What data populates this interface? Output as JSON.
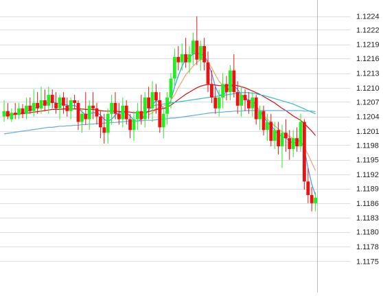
{
  "chart_data": {
    "type": "candlestick",
    "title": "",
    "xlabel": "",
    "ylabel": "",
    "ylim": [
      1.1173,
      1.12265
    ],
    "grid": true,
    "legend": "none",
    "y_ticks": [
      "1.1224",
      "1.1222",
      "1.1219",
      "1.1216",
      "1.1213",
      "1.1210",
      "1.1207",
      "1.1204",
      "1.1201",
      "1.1198",
      "1.1195",
      "1.1192",
      "1.1189",
      "1.1186",
      "1.1183",
      "1.1180",
      "1.1178",
      "1.1175"
    ],
    "y_tick_values": [
      1.1224,
      1.12215,
      1.12188,
      1.12162,
      1.12135,
      1.12108,
      1.12082,
      1.12055,
      1.12028,
      1.12002,
      1.11975,
      1.11948,
      1.11922,
      1.11895,
      1.11868,
      1.11842,
      1.11815,
      1.11788
    ],
    "colors": {
      "up": "#22ee22",
      "down": "#ee1111",
      "ma_short": "#3399ff",
      "ma_mid": "#f0a070",
      "ma_long": "#cc1111",
      "ma_longer": "#33bbcc",
      "ma_longest": "#66aadd",
      "grid": "#dddddd",
      "axis": "#bbbbbb",
      "label": "#222222"
    },
    "candles": [
      [
        1.12055,
        1.12085,
        1.12045,
        1.12065
      ],
      [
        1.12065,
        1.1208,
        1.1205,
        1.12055
      ],
      [
        1.1205,
        1.1207,
        1.12045,
        1.12062
      ],
      [
        1.12062,
        1.1208,
        1.1205,
        1.12058
      ],
      [
        1.12058,
        1.1208,
        1.1205,
        1.1207
      ],
      [
        1.1207,
        1.12078,
        1.12052,
        1.1206
      ],
      [
        1.1206,
        1.1209,
        1.1205,
        1.12075
      ],
      [
        1.12075,
        1.1209,
        1.1206,
        1.12065
      ],
      [
        1.12065,
        1.12105,
        1.12055,
        1.1208
      ],
      [
        1.1208,
        1.121,
        1.1206,
        1.1207
      ],
      [
        1.1207,
        1.1211,
        1.1206,
        1.12085
      ],
      [
        1.12085,
        1.12105,
        1.12065,
        1.12075
      ],
      [
        1.12075,
        1.1211,
        1.1206,
        1.12095
      ],
      [
        1.12095,
        1.12105,
        1.1207,
        1.1208
      ],
      [
        1.1208,
        1.121,
        1.1206,
        1.1207
      ],
      [
        1.1207,
        1.12095,
        1.1205,
        1.1209
      ],
      [
        1.1209,
        1.121,
        1.1206,
        1.12075
      ],
      [
        1.12075,
        1.1209,
        1.12055,
        1.12065
      ],
      [
        1.12065,
        1.1209,
        1.1205,
        1.12085
      ],
      [
        1.12085,
        1.12095,
        1.1207,
        1.1208
      ],
      [
        1.1208,
        1.12085,
        1.1203,
        1.12045
      ],
      [
        1.12045,
        1.1207,
        1.12025,
        1.1206
      ],
      [
        1.1206,
        1.121,
        1.1204,
        1.1205
      ],
      [
        1.1205,
        1.12085,
        1.1203,
        1.12075
      ],
      [
        1.12075,
        1.121,
        1.1205,
        1.1207
      ],
      [
        1.1207,
        1.1208,
        1.1204,
        1.12055
      ],
      [
        1.12055,
        1.12065,
        1.12015,
        1.12035
      ],
      [
        1.12035,
        1.1206,
        1.12005,
        1.12025
      ],
      [
        1.12025,
        1.1207,
        1.12005,
        1.1206
      ],
      [
        1.1206,
        1.12095,
        1.1204,
        1.1208
      ],
      [
        1.1208,
        1.121,
        1.1205,
        1.1206
      ],
      [
        1.1206,
        1.1208,
        1.1204,
        1.1205
      ],
      [
        1.1205,
        1.1209,
        1.12035,
        1.12075
      ],
      [
        1.12075,
        1.12085,
        1.1204,
        1.1205
      ],
      [
        1.1205,
        1.1206,
        1.12015,
        1.1203
      ],
      [
        1.1203,
        1.12065,
        1.1201,
        1.1205
      ],
      [
        1.1205,
        1.1208,
        1.1203,
        1.12065
      ],
      [
        1.12065,
        1.12095,
        1.1204,
        1.1205
      ],
      [
        1.1205,
        1.121,
        1.12035,
        1.1209
      ],
      [
        1.1209,
        1.1211,
        1.1205,
        1.1207
      ],
      [
        1.1207,
        1.1212,
        1.12045,
        1.121
      ],
      [
        1.121,
        1.12115,
        1.1206,
        1.12085
      ],
      [
        1.12085,
        1.121,
        1.12025,
        1.12035
      ],
      [
        1.12035,
        1.1207,
        1.12015,
        1.1206
      ],
      [
        1.1206,
        1.121,
        1.1204,
        1.1209
      ],
      [
        1.1209,
        1.12135,
        1.1207,
        1.12125
      ],
      [
        1.12125,
        1.1218,
        1.1211,
        1.12165
      ],
      [
        1.12165,
        1.12185,
        1.1214,
        1.12155
      ],
      [
        1.12155,
        1.1219,
        1.1214,
        1.1217
      ],
      [
        1.1217,
        1.122,
        1.12145,
        1.12155
      ],
      [
        1.12155,
        1.12185,
        1.12135,
        1.1217
      ],
      [
        1.1217,
        1.1221,
        1.1215,
        1.12195
      ],
      [
        1.12195,
        1.1224,
        1.1215,
        1.1216
      ],
      [
        1.1216,
        1.12195,
        1.1214,
        1.12185
      ],
      [
        1.12185,
        1.122,
        1.1214,
        1.12155
      ],
      [
        1.12155,
        1.12175,
        1.121,
        1.12115
      ],
      [
        1.12115,
        1.1214,
        1.1208,
        1.1209
      ],
      [
        1.1209,
        1.1211,
        1.1206,
        1.1207
      ],
      [
        1.1207,
        1.12105,
        1.12055,
        1.1209
      ],
      [
        1.1209,
        1.12135,
        1.1207,
        1.12115
      ],
      [
        1.12115,
        1.1213,
        1.12085,
        1.121
      ],
      [
        1.121,
        1.1215,
        1.12085,
        1.1214
      ],
      [
        1.1214,
        1.1217,
        1.1209,
        1.121
      ],
      [
        1.121,
        1.1212,
        1.1206,
        1.12075
      ],
      [
        1.12075,
        1.1211,
        1.12055,
        1.12095
      ],
      [
        1.12095,
        1.12105,
        1.12065,
        1.12085
      ],
      [
        1.12085,
        1.121,
        1.1206,
        1.1207
      ],
      [
        1.1207,
        1.121,
        1.12055,
        1.1209
      ],
      [
        1.1209,
        1.12095,
        1.1204,
        1.1205
      ],
      [
        1.1205,
        1.12075,
        1.1203,
        1.12065
      ],
      [
        1.12065,
        1.12075,
        1.1202,
        1.1203
      ],
      [
        1.1203,
        1.1206,
        1.1201,
        1.12045
      ],
      [
        1.12045,
        1.1206,
        1.12,
        1.1201
      ],
      [
        1.1201,
        1.12045,
        1.11995,
        1.1203
      ],
      [
        1.1203,
        1.12045,
        1.11985,
        1.12
      ],
      [
        1.12,
        1.1204,
        1.1196,
        1.12025
      ],
      [
        1.12025,
        1.1205,
        1.1199,
        1.12015
      ],
      [
        1.12015,
        1.1203,
        1.11975,
        1.11995
      ],
      [
        1.11995,
        1.1203,
        1.1198,
        1.12015
      ],
      [
        1.12015,
        1.12035,
        1.1199,
        1.12
      ],
      [
        1.12,
        1.1206,
        1.1199,
        1.12045
      ],
      [
        1.12045,
        1.1205,
        1.1192,
        1.11935
      ],
      [
        1.11935,
        1.1196,
        1.11895,
        1.1191
      ],
      [
        1.1191,
        1.11925,
        1.1188,
        1.11895
      ],
      [
        1.11895,
        1.11915,
        1.1188,
        1.11905
      ]
    ],
    "moving_averages": [
      {
        "color": "ma_short",
        "values": [
          1.12062,
          1.1206,
          1.12058,
          1.1206,
          1.12062,
          1.1206,
          1.12064,
          1.12066,
          1.1207,
          1.12072,
          1.12076,
          1.12078,
          1.12082,
          1.12083,
          1.1208,
          1.12078,
          1.12078,
          1.12076,
          1.12074,
          1.12076,
          1.1207,
          1.12064,
          1.12058,
          1.1206,
          1.12062,
          1.12062,
          1.12058,
          1.1205,
          1.12046,
          1.1205,
          1.12058,
          1.12062,
          1.12062,
          1.12062,
          1.12056,
          1.12048,
          1.12046,
          1.1205,
          1.12058,
          1.12066,
          1.12076,
          1.12085,
          1.1208,
          1.1207,
          1.1207,
          1.12085,
          1.1211,
          1.1213,
          1.12148,
          1.1216,
          1.12165,
          1.1217,
          1.12172,
          1.1217,
          1.12168,
          1.12155,
          1.12135,
          1.1211,
          1.12095,
          1.12095,
          1.121,
          1.1211,
          1.12112,
          1.12105,
          1.12095,
          1.1209,
          1.12085,
          1.12085,
          1.12075,
          1.12065,
          1.12055,
          1.12045,
          1.12038,
          1.1203,
          1.12022,
          1.12018,
          1.12015,
          1.1201,
          1.12005,
          1.12008,
          1.12012,
          1.11995,
          1.1196,
          1.1193,
          1.1191
        ]
      },
      {
        "color": "ma_mid",
        "values": [
          null,
          null,
          null,
          null,
          null,
          null,
          null,
          null,
          null,
          null,
          null,
          null,
          null,
          null,
          null,
          null,
          null,
          null,
          null,
          null,
          null,
          null,
          null,
          null,
          null,
          null,
          null,
          null,
          null,
          null,
          null,
          null,
          null,
          null,
          null,
          null,
          null,
          null,
          null,
          1.12058,
          1.12062,
          1.12068,
          1.12072,
          1.12074,
          1.12078,
          1.12085,
          1.12095,
          1.12108,
          1.1212,
          1.12132,
          1.1214,
          1.12148,
          1.12155,
          1.1216,
          1.1216,
          1.12155,
          1.12145,
          1.12132,
          1.1212,
          1.12112,
          1.12108,
          1.12105,
          1.12102,
          1.12098,
          1.12093,
          1.12088,
          1.12083,
          1.12078,
          1.12072,
          1.12066,
          1.12058,
          1.1205,
          1.12044,
          1.12038,
          1.12032,
          1.12027,
          1.12022,
          1.12018,
          1.12014,
          1.1201,
          1.12008,
          1.11998,
          1.11985,
          1.1197,
          1.11955
        ]
      },
      {
        "color": "ma_long",
        "values": [
          1.12058,
          1.12058,
          1.12058,
          1.12059,
          1.1206,
          1.1206,
          1.12061,
          1.12062,
          1.12063,
          1.12064,
          1.12065,
          1.12066,
          1.12067,
          1.12068,
          1.12068,
          1.12068,
          1.12069,
          1.12069,
          1.12069,
          1.12069,
          1.12069,
          1.12069,
          1.12068,
          1.12068,
          1.12068,
          1.12067,
          1.12066,
          1.12065,
          1.12065,
          1.12065,
          1.12065,
          1.12064,
          1.12064,
          1.12064,
          1.12063,
          1.12062,
          1.12062,
          1.12062,
          1.12063,
          1.12064,
          1.12066,
          1.12068,
          1.12069,
          1.1207,
          1.12072,
          1.12076,
          1.12081,
          1.12086,
          1.12091,
          1.12096,
          1.121,
          1.12104,
          1.12108,
          1.12111,
          1.12113,
          1.12114,
          1.12114,
          1.12113,
          1.12112,
          1.12112,
          1.12112,
          1.12113,
          1.12113,
          1.12112,
          1.1211,
          1.12108,
          1.12105,
          1.12102,
          1.12099,
          1.12096,
          1.12092,
          1.12088,
          1.12084,
          1.1208,
          1.12075,
          1.1207,
          1.12066,
          1.12061,
          1.12056,
          1.12052,
          1.12048,
          1.12042,
          1.12035,
          1.12028,
          1.1202
        ]
      },
      {
        "color": "ma_longer",
        "values": [
          null,
          null,
          null,
          null,
          null,
          null,
          null,
          null,
          null,
          null,
          null,
          null,
          null,
          null,
          null,
          null,
          null,
          null,
          null,
          null,
          null,
          null,
          null,
          null,
          null,
          null,
          null,
          null,
          null,
          null,
          null,
          null,
          null,
          null,
          null,
          null,
          null,
          null,
          null,
          null,
          1.12075,
          1.12076,
          1.12077,
          1.12078,
          1.12079,
          1.1208,
          1.12081,
          1.12082,
          1.12083,
          1.12084,
          1.12085,
          1.12086,
          1.12087,
          1.12088,
          1.12089,
          1.1209,
          1.12091,
          1.12092,
          1.12093,
          1.12094,
          1.12095,
          1.12096,
          1.12097,
          1.12098,
          1.12099,
          1.12099,
          1.12099,
          1.12098,
          1.12097,
          1.12095,
          1.12094,
          1.12092,
          1.1209,
          1.12088,
          1.12086,
          1.12084,
          1.12082,
          1.1208,
          1.12078,
          1.12075,
          1.12072,
          1.12069,
          1.12066,
          1.12063,
          1.1206
        ]
      },
      {
        "color": "ma_longest",
        "values": [
          1.12023,
          1.12024,
          1.12025,
          1.12026,
          1.12027,
          1.12028,
          1.12029,
          1.1203,
          1.12031,
          1.12032,
          1.12033,
          1.12034,
          1.12035,
          1.12035,
          1.12036,
          1.12037,
          1.12037,
          1.12038,
          1.12038,
          1.12039,
          1.12039,
          1.1204,
          1.1204,
          1.12041,
          1.12041,
          1.12042,
          1.12042,
          1.12043,
          1.12043,
          1.12044,
          1.12044,
          1.12045,
          1.12045,
          1.12046,
          1.12046,
          1.12047,
          1.12047,
          1.12047,
          1.12048,
          1.12048,
          1.12048,
          1.12049,
          1.1205,
          1.1205,
          1.12051,
          1.12052,
          1.12052,
          1.12053,
          1.12054,
          1.12055,
          1.12056,
          1.12057,
          1.12058,
          1.12059,
          1.1206,
          1.12061,
          1.12062,
          1.12062,
          1.12063,
          1.12063,
          1.12064,
          1.12064,
          1.12065,
          1.12065,
          1.12065,
          1.12066,
          1.12066,
          1.12066,
          1.12066,
          1.12066,
          1.12066,
          1.12066,
          1.12066,
          1.12066,
          1.12066,
          1.12066,
          1.12066,
          1.12066,
          1.12066,
          1.12066,
          1.12066,
          1.12065,
          1.12065,
          1.12065,
          1.12064
        ]
      }
    ]
  }
}
